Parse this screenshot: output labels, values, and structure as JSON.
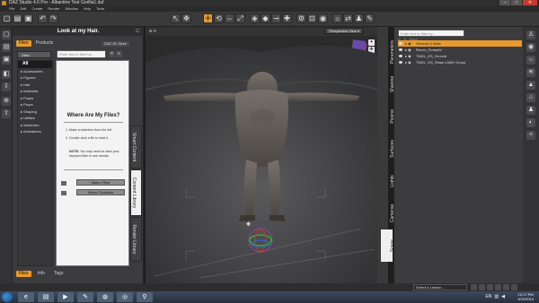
{
  "window": {
    "title": "DAZ Studio 4.6 Pro - Albantine Test Gorilla1.duf",
    "min": "–",
    "max": "□",
    "close": "✕"
  },
  "menubar": [
    "File",
    "Edit",
    "Create",
    "Render",
    "Window",
    "Help",
    "Tools"
  ],
  "left_panel": {
    "title": "Look at my Hair.",
    "pin": "⊏",
    "tabs": [
      "Files",
      "Products"
    ],
    "active_tab": "Files",
    "daz_store": "DAZ 3D Store",
    "view_button": "View",
    "filter_placeholder": "Enter text to filter by...",
    "categories": [
      "All",
      "Accessories",
      "Figures",
      "Hair",
      "Materials",
      "Poses",
      "Props",
      "Shaping",
      "Utilities",
      "Wardrobe",
      "Animations"
    ],
    "where": {
      "heading": "Where Are My Files?",
      "step1": "1. Make a selection from the left.",
      "step2": "2. Double-click a file to load it.",
      "note_label": "NOTE:",
      "note_text": "You may need to clear your keyword filter to see results.",
      "btn_video": "Video: Files",
      "btn_products": "Video: Products"
    },
    "vertical_tabs": [
      "Smart Content",
      "Content Library",
      "Render Library"
    ],
    "bottom_tabs": [
      "Files",
      "Info",
      "Tags"
    ]
  },
  "viewport": {
    "header_left": "⊞ ⊟",
    "camera": "Perspective View ▾"
  },
  "right_panel": {
    "filter_placeholder": "Enter text to filter by...",
    "columns": [
      "⊙",
      "⊘",
      "Scene"
    ],
    "nodes": [
      {
        "label": "Genesis 2 Male",
        "selected": true
      },
      {
        "label": "Recon_Scrambl"
      },
      {
        "label": "TMDL_DS_Ground"
      },
      {
        "label": "TMDL_DS_Shaw LAMH Group"
      }
    ],
    "vertical_tabs": [
      "Parameters",
      "Shaping",
      "Posing",
      "Surfaces",
      "Lights",
      "Cameras",
      "Scene"
    ]
  },
  "lesson": "Select a Lesson...",
  "taskbar": {
    "time": "12:17 PM",
    "date": "10/2/2014",
    "lang": "EN"
  }
}
